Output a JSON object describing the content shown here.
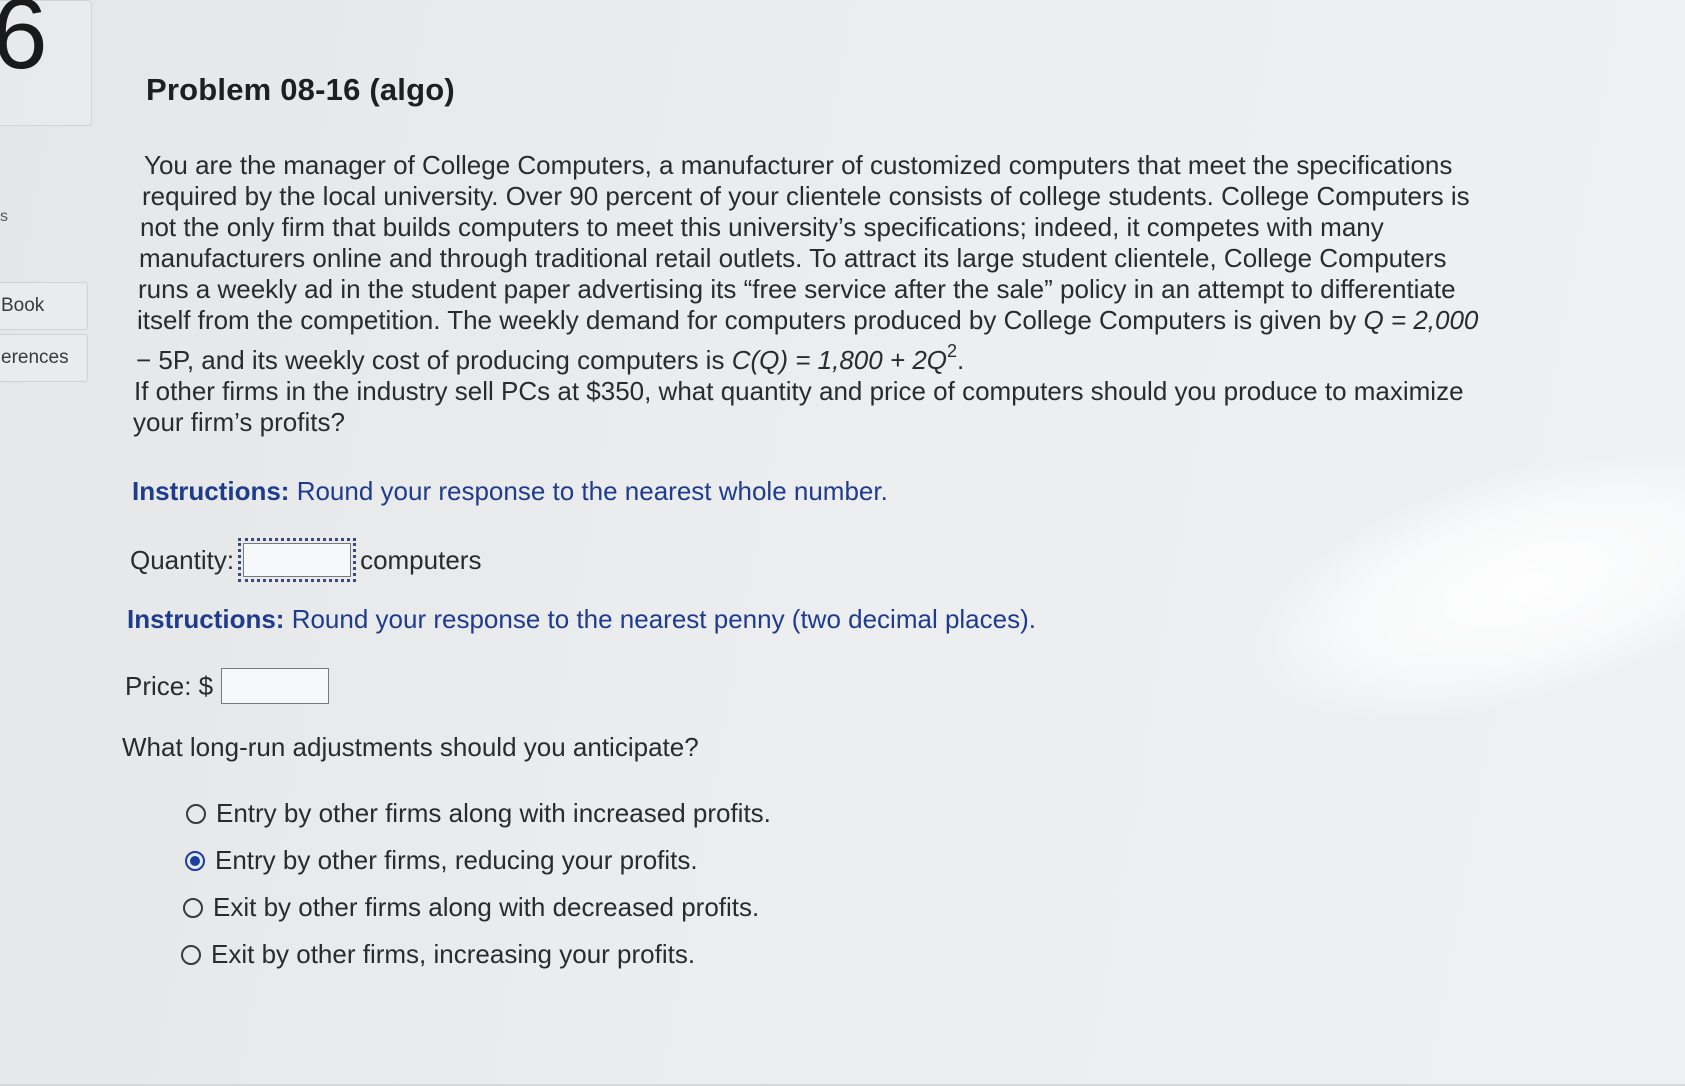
{
  "sidebar": {
    "question_number": "6",
    "partial_letter": "s",
    "book_label": "Book",
    "references_label": "erences"
  },
  "problem": {
    "title": "Problem 08-16 (algo)",
    "lines": [
      "You are the manager of College Computers, a manufacturer of customized computers that meet the specifications",
      "required by the local university. Over 90 percent of your clientele consists of college students. College Computers is",
      "not the only firm that builds computers to meet this university’s specifications; indeed, it competes with many",
      "manufacturers online and through traditional retail outlets. To attract its large student clientele, College Computers",
      "runs a weekly ad in the student paper advertising its “free service after the sale” policy in an attempt to differentiate",
      "itself from the competition. The weekly demand for computers produced by College Computers is given by",
      "If other firms in the industry sell PCs at $350, what quantity and price of computers should you produce to maximize",
      "your firm’s profits?"
    ],
    "demand_eq": "Q = 2,000",
    "demand_cont": "− 5P",
    "cost_intro": ", and its weekly cost of producing computers is",
    "cost_eq": "C(Q) = 1,800 + 2Q",
    "cost_exp": "2",
    "cost_end": "."
  },
  "instructions": {
    "label": "Instructions:",
    "quantity_text": "Round your response to the nearest whole number.",
    "price_text": "Round your response to the nearest penny (two decimal places)."
  },
  "quantity": {
    "label": "Quantity:",
    "value": "",
    "unit": "computers"
  },
  "price": {
    "label": "Price: $",
    "value": ""
  },
  "longrun": {
    "question": "What long-run adjustments should you anticipate?",
    "options": [
      {
        "label": "Entry by other firms along with increased profits.",
        "selected": false
      },
      {
        "label": "Entry by other firms, reducing your profits.",
        "selected": true
      },
      {
        "label": "Exit by other firms along with decreased profits.",
        "selected": false
      },
      {
        "label": "Exit by other firms, increasing your profits.",
        "selected": false
      }
    ]
  },
  "colors": {
    "instruction_blue": "#1f3c8c",
    "radio_selected": "#1a3f9c",
    "text": "#2b2b2b"
  }
}
